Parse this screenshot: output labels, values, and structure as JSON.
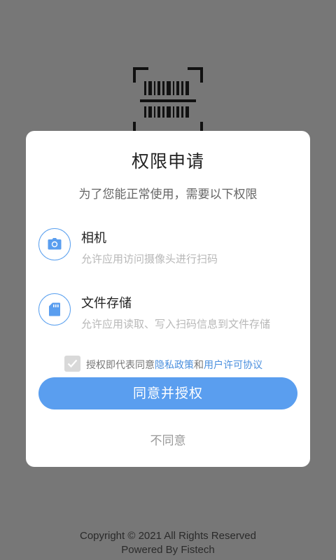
{
  "background": {
    "icon": "barcode-scanner-icon"
  },
  "dialog": {
    "title": "权限申请",
    "subtitle": "为了您能正常使用，需要以下权限",
    "permissions": [
      {
        "icon": "camera-icon",
        "name": "相机",
        "description": "允许应用访问摄像头进行扫码"
      },
      {
        "icon": "sd-card-icon",
        "name": "文件存储",
        "description": "允许应用读取、写入扫码信息到文件存储"
      }
    ],
    "consent": {
      "checked": true,
      "prefix": "授权即代表同意",
      "privacy_link": "隐私政策",
      "conjunction": "和",
      "license_link": "用户许可协议"
    },
    "agree_label": "同意并授权",
    "disagree_label": "不同意"
  },
  "footer": {
    "copyright": "Copyright © 2021 All Rights Reserved",
    "powered_by": "Powered By Fistech"
  },
  "colors": {
    "overlay": "#777777",
    "accent": "#5a9eef",
    "link": "#4a8fde"
  }
}
